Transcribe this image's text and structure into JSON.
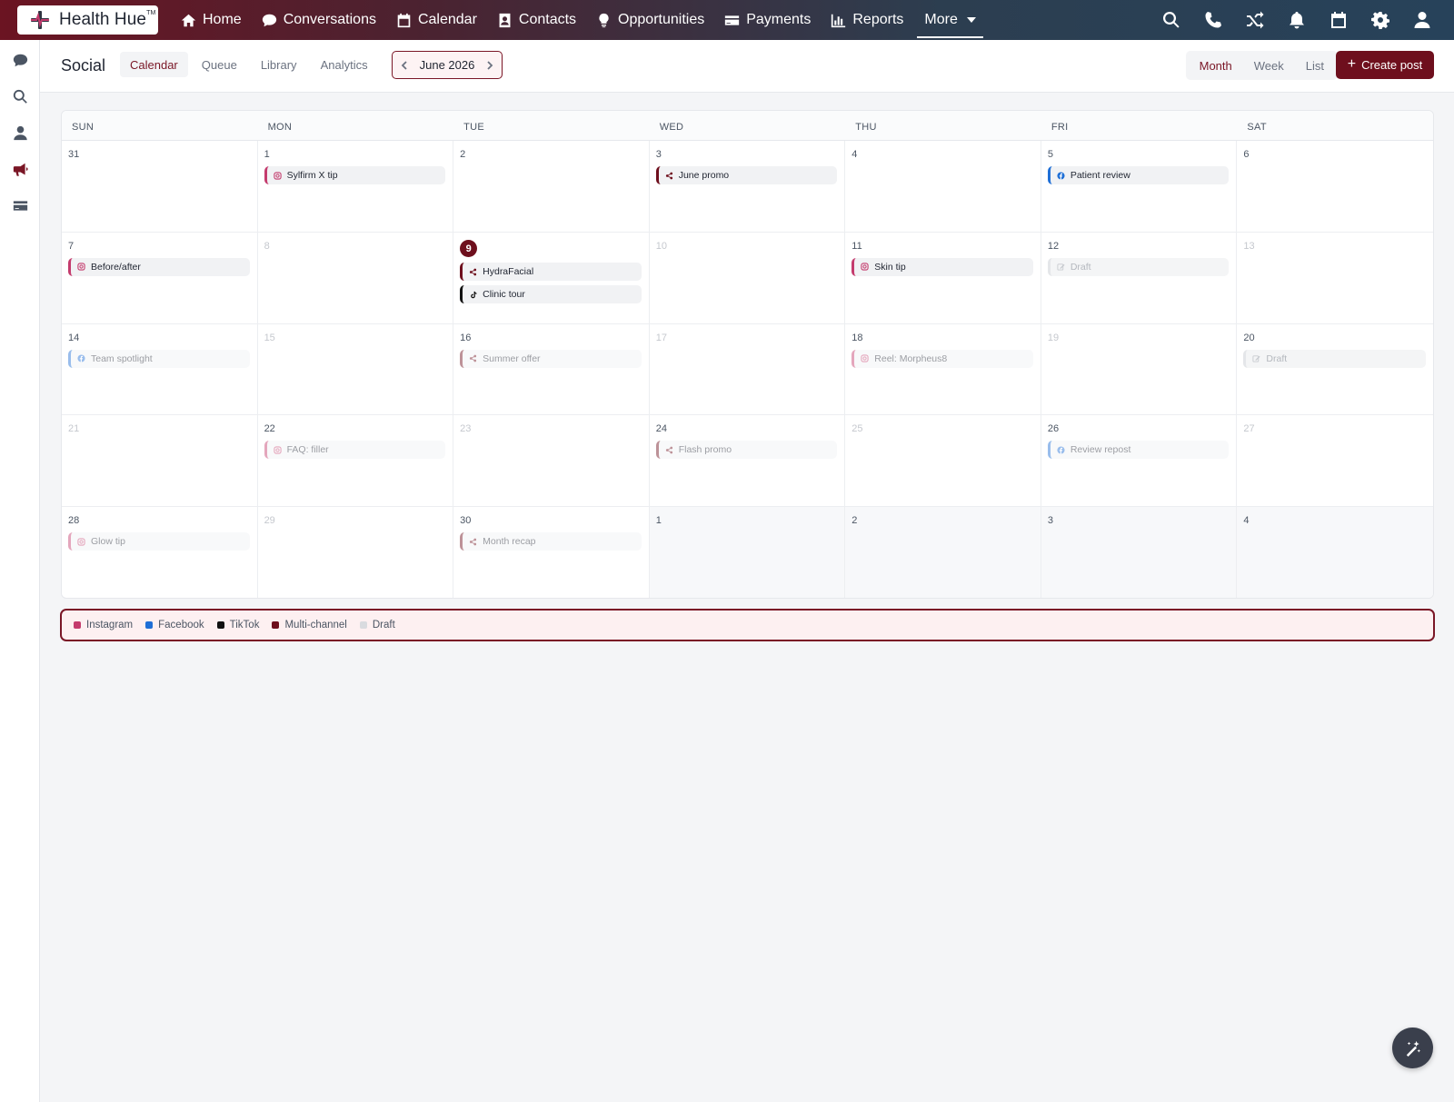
{
  "brand": {
    "name": "Health Hue",
    "mark": "TM"
  },
  "nav": [
    {
      "label": "Home",
      "icon": "home-icon"
    },
    {
      "label": "Conversations",
      "icon": "chat-icon"
    },
    {
      "label": "Calendar",
      "icon": "calendar-icon"
    },
    {
      "label": "Contacts",
      "icon": "contact-card-icon"
    },
    {
      "label": "Opportunities",
      "icon": "lightbulb-icon"
    },
    {
      "label": "Payments",
      "icon": "credit-card-icon"
    },
    {
      "label": "Reports",
      "icon": "bar-chart-icon"
    }
  ],
  "nav_more": "More",
  "top_icons": [
    "search-icon",
    "phone-icon",
    "shuffle-icon",
    "bell-icon",
    "calendar-icon",
    "gear-icon",
    "user-icon"
  ],
  "rail": [
    "chat-icon",
    "search-icon",
    "user-icon",
    "megaphone-icon",
    "card-icon"
  ],
  "header": {
    "title": "Social",
    "tabs": [
      "Calendar",
      "Queue",
      "Library",
      "Analytics"
    ],
    "active_tab": "Calendar",
    "month": "June 2026",
    "views": [
      "Month",
      "Week",
      "List"
    ],
    "active_view": "Month",
    "create_label": "Create post"
  },
  "colors": {
    "instagram": "#c43b6d",
    "facebook": "#1f6fd6",
    "tiktok": "#111111",
    "multi": "#6e0f1d",
    "draft": "#d9dbdf",
    "accent": "#7a1626"
  },
  "weekdays": [
    "SUN",
    "MON",
    "TUE",
    "WED",
    "THU",
    "FRI",
    "SAT"
  ],
  "weeks": [
    [
      {
        "day": "31",
        "state": "normal",
        "events": []
      },
      {
        "day": "1",
        "state": "normal",
        "events": [
          {
            "title": "Sylfirm X tip",
            "channel": "instagram",
            "style": "normal"
          }
        ]
      },
      {
        "day": "2",
        "state": "normal",
        "events": []
      },
      {
        "day": "3",
        "state": "normal",
        "events": [
          {
            "title": "June promo",
            "channel": "multi",
            "style": "normal"
          }
        ]
      },
      {
        "day": "4",
        "state": "normal",
        "events": []
      },
      {
        "day": "5",
        "state": "normal",
        "events": [
          {
            "title": "Patient review",
            "channel": "facebook",
            "style": "normal"
          }
        ]
      },
      {
        "day": "6",
        "state": "normal",
        "events": []
      }
    ],
    [
      {
        "day": "7",
        "state": "normal",
        "events": [
          {
            "title": "Before/after",
            "channel": "instagram",
            "style": "normal"
          }
        ]
      },
      {
        "day": "8",
        "state": "muted",
        "events": []
      },
      {
        "day": "9",
        "state": "today",
        "events": [
          {
            "title": "HydraFacial",
            "channel": "multi",
            "style": "normal"
          },
          {
            "title": "Clinic tour",
            "channel": "tiktok",
            "style": "normal"
          }
        ]
      },
      {
        "day": "10",
        "state": "muted",
        "events": []
      },
      {
        "day": "11",
        "state": "normal",
        "events": [
          {
            "title": "Skin tip",
            "channel": "instagram",
            "style": "normal"
          }
        ]
      },
      {
        "day": "12",
        "state": "normal",
        "events": [
          {
            "title": "Draft",
            "channel": "draft",
            "style": "draft"
          }
        ]
      },
      {
        "day": "13",
        "state": "muted",
        "events": []
      }
    ],
    [
      {
        "day": "14",
        "state": "normal",
        "events": [
          {
            "title": "Team spotlight",
            "channel": "facebook",
            "style": "faded"
          }
        ]
      },
      {
        "day": "15",
        "state": "muted",
        "events": []
      },
      {
        "day": "16",
        "state": "normal",
        "events": [
          {
            "title": "Summer offer",
            "channel": "multi",
            "style": "faded"
          }
        ]
      },
      {
        "day": "17",
        "state": "muted",
        "events": []
      },
      {
        "day": "18",
        "state": "normal",
        "events": [
          {
            "title": "Reel: Morpheus8",
            "channel": "instagram",
            "style": "faded"
          }
        ]
      },
      {
        "day": "19",
        "state": "muted",
        "events": []
      },
      {
        "day": "20",
        "state": "normal",
        "events": [
          {
            "title": "Draft",
            "channel": "draft",
            "style": "draft"
          }
        ]
      }
    ],
    [
      {
        "day": "21",
        "state": "muted",
        "events": []
      },
      {
        "day": "22",
        "state": "normal",
        "events": [
          {
            "title": "FAQ: filler",
            "channel": "instagram",
            "style": "faded"
          }
        ]
      },
      {
        "day": "23",
        "state": "muted",
        "events": []
      },
      {
        "day": "24",
        "state": "normal",
        "events": [
          {
            "title": "Flash promo",
            "channel": "multi",
            "style": "faded"
          }
        ]
      },
      {
        "day": "25",
        "state": "muted",
        "events": []
      },
      {
        "day": "26",
        "state": "normal",
        "events": [
          {
            "title": "Review repost",
            "channel": "facebook",
            "style": "faded"
          }
        ]
      },
      {
        "day": "27",
        "state": "muted",
        "events": []
      }
    ],
    [
      {
        "day": "28",
        "state": "normal",
        "events": [
          {
            "title": "Glow tip",
            "channel": "instagram",
            "style": "faded"
          }
        ]
      },
      {
        "day": "29",
        "state": "muted",
        "events": []
      },
      {
        "day": "30",
        "state": "normal",
        "events": [
          {
            "title": "Month recap",
            "channel": "multi",
            "style": "faded"
          }
        ]
      },
      {
        "day": "1",
        "state": "outside",
        "events": []
      },
      {
        "day": "2",
        "state": "outside",
        "events": []
      },
      {
        "day": "3",
        "state": "outside",
        "events": []
      },
      {
        "day": "4",
        "state": "outside",
        "events": []
      }
    ]
  ],
  "legend": [
    {
      "label": "Instagram",
      "channel": "instagram"
    },
    {
      "label": "Facebook",
      "channel": "facebook"
    },
    {
      "label": "TikTok",
      "channel": "tiktok"
    },
    {
      "label": "Multi-channel",
      "channel": "multi"
    },
    {
      "label": "Draft",
      "channel": "draft"
    }
  ],
  "fab_icon": "magic-wand-icon"
}
